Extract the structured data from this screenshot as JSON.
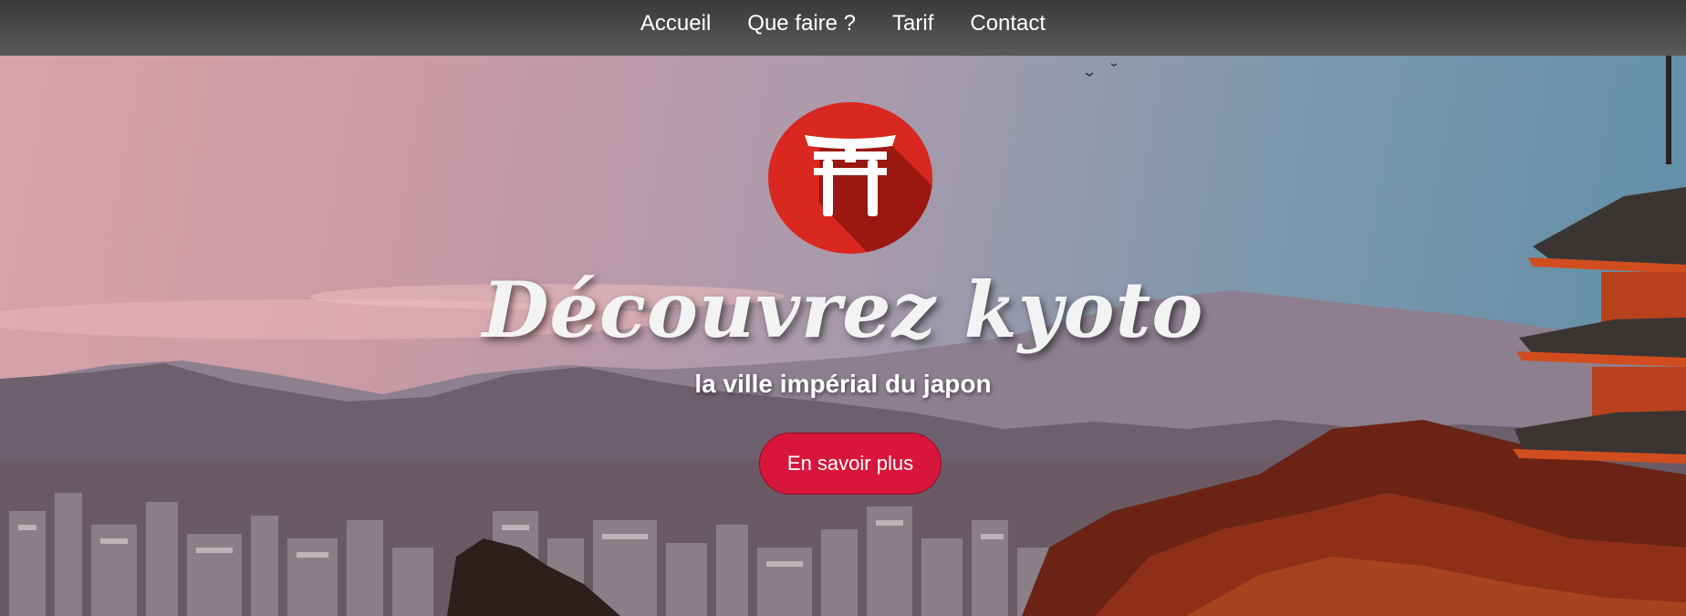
{
  "nav": {
    "items": [
      {
        "label": "Accueil"
      },
      {
        "label": "Que faire ?"
      },
      {
        "label": "Tarif"
      },
      {
        "label": "Contact"
      }
    ]
  },
  "hero": {
    "logo_icon": "torii-gate-icon",
    "title": "Découvrez kyoto",
    "subtitle": "la ville impérial du japon",
    "cta_label": "En savoir plus"
  },
  "colors": {
    "accent": "#d8163c",
    "logo_bg": "#d9281f",
    "nav_bg": "#4a4a4a"
  }
}
